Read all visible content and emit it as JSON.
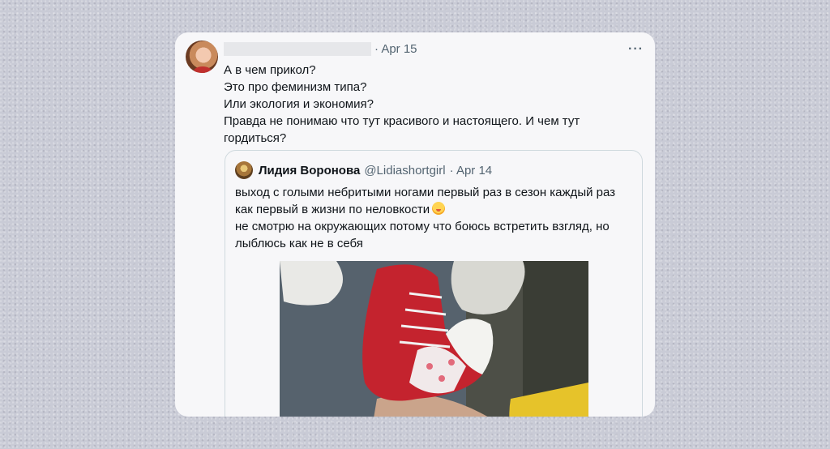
{
  "tweet": {
    "date": "· Apr 15",
    "more_label": "···",
    "lines": [
      "А в чем прикол?",
      "Это про феминизм типа?",
      "Или экология и экономия?",
      "Правда не понимаю что тут красивого и настоящего. И чем тут",
      "гордиться?"
    ]
  },
  "quoted": {
    "name": "Лидия Воронова",
    "handle": "@Lidiashortgirl",
    "date": "· Apr 14",
    "lines": [
      "выход с голыми небритыми ногами первый раз в сезон каждый раз",
      "как первый в жизни по неловкости",
      "не смотрю на окружающих потому что боюсь встретить взгляд, но",
      "лыблюсь как не в себя"
    ],
    "emoji": "face-with-hand-over-mouth-emoji"
  },
  "colors": {
    "background": "#c9cbd6",
    "card": "#f7f7f9",
    "text": "#0f1419",
    "muted": "#536471",
    "border": "#cfd9de"
  }
}
